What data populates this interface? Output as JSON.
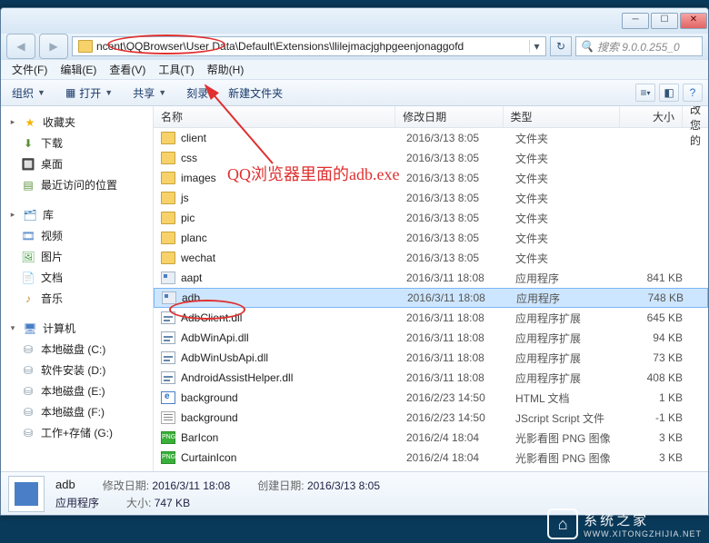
{
  "address_path": "ncent\\QQBrowser\\User Data\\Default\\Extensions\\llilejmacjghpgeenjonaggofd",
  "search_placeholder": "搜索 9.0.0.255_0",
  "menubar": {
    "file": "文件(F)",
    "edit": "编辑(E)",
    "view": "查看(V)",
    "tools": "工具(T)",
    "help": "帮助(H)"
  },
  "toolbar": {
    "organize": "组织",
    "open": "打开",
    "share": "共享",
    "burn": "刻录",
    "newfolder": "新建文件夹"
  },
  "sidebar": {
    "fav": "收藏夹",
    "dl": "下载",
    "desk": "桌面",
    "recent": "最近访问的位置",
    "lib": "库",
    "vid": "视频",
    "pic": "图片",
    "doc": "文档",
    "mus": "音乐",
    "comp": "计算机",
    "drvC": "本地磁盘 (C:)",
    "drvD": "软件安装 (D:)",
    "drvE": "本地磁盘 (E:)",
    "drvF": "本地磁盘 (F:)",
    "drvG": "工作+存储 (G:)"
  },
  "columns": {
    "name": "名称",
    "date": "修改日期",
    "type": "类型",
    "size": "大小",
    "change": "更改您的"
  },
  "rows": [
    {
      "icon": "folder",
      "name": "client",
      "date": "2016/3/13 8:05",
      "type": "文件夹",
      "size": ""
    },
    {
      "icon": "folder",
      "name": "css",
      "date": "2016/3/13 8:05",
      "type": "文件夹",
      "size": ""
    },
    {
      "icon": "folder",
      "name": "images",
      "date": "2016/3/13 8:05",
      "type": "文件夹",
      "size": ""
    },
    {
      "icon": "folder",
      "name": "js",
      "date": "2016/3/13 8:05",
      "type": "文件夹",
      "size": ""
    },
    {
      "icon": "folder",
      "name": "pic",
      "date": "2016/3/13 8:05",
      "type": "文件夹",
      "size": ""
    },
    {
      "icon": "folder",
      "name": "planc",
      "date": "2016/3/13 8:05",
      "type": "文件夹",
      "size": ""
    },
    {
      "icon": "folder",
      "name": "wechat",
      "date": "2016/3/13 8:05",
      "type": "文件夹",
      "size": ""
    },
    {
      "icon": "exe",
      "name": "aapt",
      "date": "2016/3/11 18:08",
      "type": "应用程序",
      "size": "841 KB"
    },
    {
      "icon": "exe",
      "name": "adb",
      "date": "2016/3/11 18:08",
      "type": "应用程序",
      "size": "748 KB",
      "sel": true
    },
    {
      "icon": "dll",
      "name": "AdbClient.dll",
      "date": "2016/3/11 18:08",
      "type": "应用程序扩展",
      "size": "645 KB"
    },
    {
      "icon": "dll",
      "name": "AdbWinApi.dll",
      "date": "2016/3/11 18:08",
      "type": "应用程序扩展",
      "size": "94 KB"
    },
    {
      "icon": "dll",
      "name": "AdbWinUsbApi.dll",
      "date": "2016/3/11 18:08",
      "type": "应用程序扩展",
      "size": "73 KB"
    },
    {
      "icon": "dll",
      "name": "AndroidAssistHelper.dll",
      "date": "2016/3/11 18:08",
      "type": "应用程序扩展",
      "size": "408 KB"
    },
    {
      "icon": "html",
      "name": "background",
      "date": "2016/2/23 14:50",
      "type": "HTML 文档",
      "size": "1 KB"
    },
    {
      "icon": "js",
      "name": "background",
      "date": "2016/2/23 14:50",
      "type": "JScript Script 文件",
      "size": "-1 KB"
    },
    {
      "icon": "png",
      "name": "BarIcon",
      "date": "2016/2/4 18:04",
      "type": "光影看图 PNG 图像",
      "size": "3 KB"
    },
    {
      "icon": "png",
      "name": "CurtainIcon",
      "date": "2016/2/4 18:04",
      "type": "光影看图 PNG 图像",
      "size": "3 KB"
    }
  ],
  "details": {
    "name": "adb",
    "type": "应用程序",
    "mod_lbl": "修改日期:",
    "mod_val": "2016/3/11 18:08",
    "crt_lbl": "创建日期:",
    "crt_val": "2016/3/13 8:05",
    "size_lbl": "大小:",
    "size_val": "747 KB"
  },
  "annotation_text": "QQ浏览器里面的adb.exe",
  "watermark": {
    "brand": "系统之家",
    "url": "WWW.XITONGZHIJIA.NET"
  }
}
